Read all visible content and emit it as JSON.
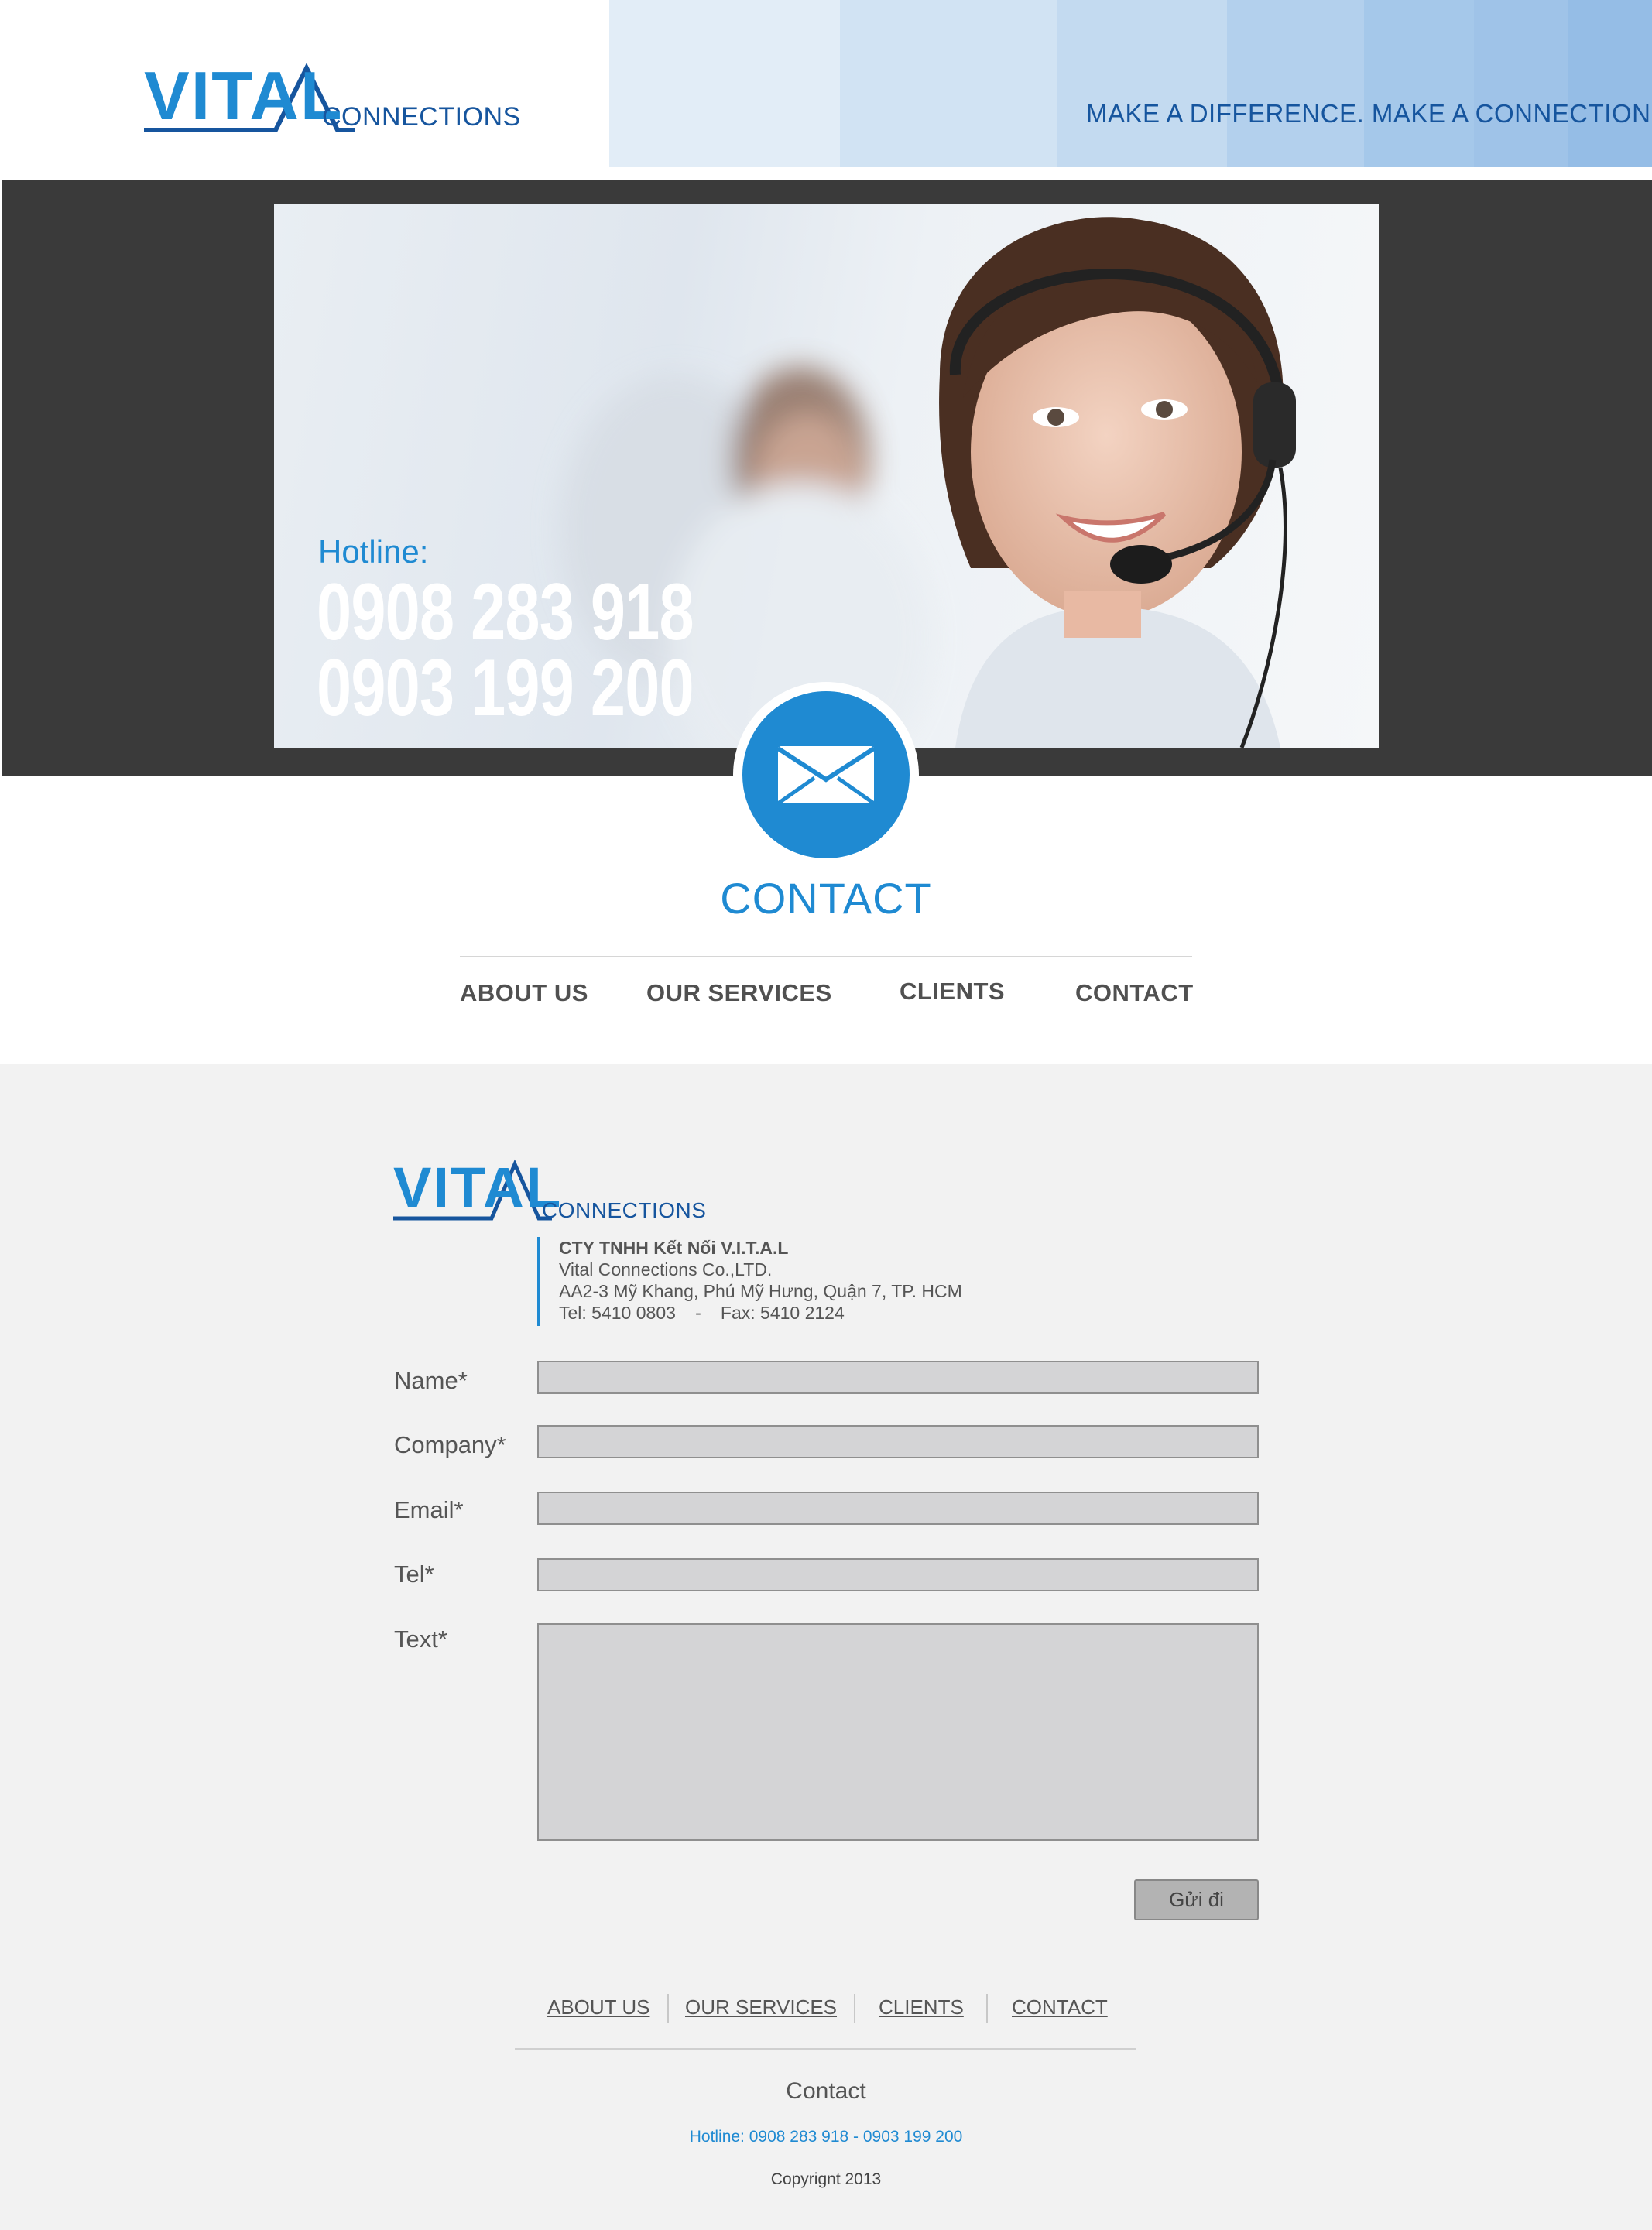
{
  "brand": {
    "logo_word": "VITAL",
    "logo_sub": "CONNECTIONS",
    "tagline": "MAKE A DIFFERENCE. MAKE A CONNECTION.",
    "colors": {
      "accent": "#1f8ad2",
      "navy": "#16559e",
      "dark": "#3a3a3a"
    }
  },
  "hero": {
    "hotline_label": "Hotline:",
    "phone_1": "0908 283 918",
    "phone_2": "0903 199 200"
  },
  "contact_icon": "envelope-icon",
  "page_heading": "CONTACT",
  "main_nav": [
    "ABOUT US",
    "OUR SERVICES",
    "CLIENTS",
    "CONTACT"
  ],
  "address": {
    "company_vi": "CTY TNHH Kết Nối V.I.T.A.L",
    "company_en": "Vital Connections Co.,LTD.",
    "street": "AA2-3 Mỹ Khang, Phú Mỹ Hưng, Quận 7, TP. HCM",
    "tel": "Tel: 5410 0803",
    "separator": "-",
    "fax": "Fax: 5410 2124"
  },
  "form": {
    "name_label": "Name*",
    "company_label": "Company*",
    "email_label": "Email*",
    "tel_label": "Tel*",
    "text_label": "Text*",
    "name_value": "",
    "company_value": "",
    "email_value": "",
    "tel_value": "",
    "text_value": "",
    "submit_label": "Gửi đi"
  },
  "footer": {
    "nav": [
      "ABOUT US",
      "OUR SERVICES",
      "CLIENTS",
      "CONTACT"
    ],
    "title": "Contact",
    "hotline": "Hotline: 0908 283 918  -  0903 199 200",
    "copyright": "Copyrignt 2013"
  }
}
